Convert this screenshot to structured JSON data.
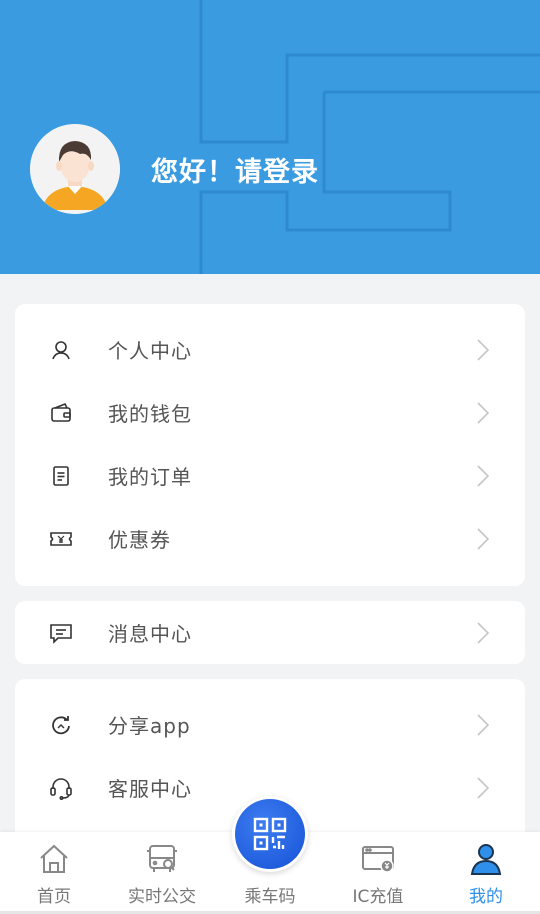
{
  "header": {
    "greeting": "您好！请登录",
    "bg_color": "#3a9be0"
  },
  "menu_group_1": [
    {
      "label": "个人中心",
      "icon": "user-icon"
    },
    {
      "label": "我的钱包",
      "icon": "wallet-icon"
    },
    {
      "label": "我的订单",
      "icon": "order-icon"
    },
    {
      "label": "优惠券",
      "icon": "coupon-icon"
    }
  ],
  "menu_group_2": [
    {
      "label": "消息中心",
      "icon": "message-icon"
    }
  ],
  "menu_group_3": [
    {
      "label": "分享app",
      "icon": "share-icon"
    },
    {
      "label": "客服中心",
      "icon": "headset-icon"
    }
  ],
  "tabbar": {
    "tabs": [
      {
        "label": "首页",
        "icon": "home-icon"
      },
      {
        "label": "实时公交",
        "icon": "bus-search-icon"
      },
      {
        "label": "乘车码",
        "icon": "qr-code-icon"
      },
      {
        "label": "IC充值",
        "icon": "ic-card-recharge-icon"
      },
      {
        "label": "我的",
        "icon": "profile-icon"
      }
    ],
    "active_color": "#2f8fea"
  }
}
